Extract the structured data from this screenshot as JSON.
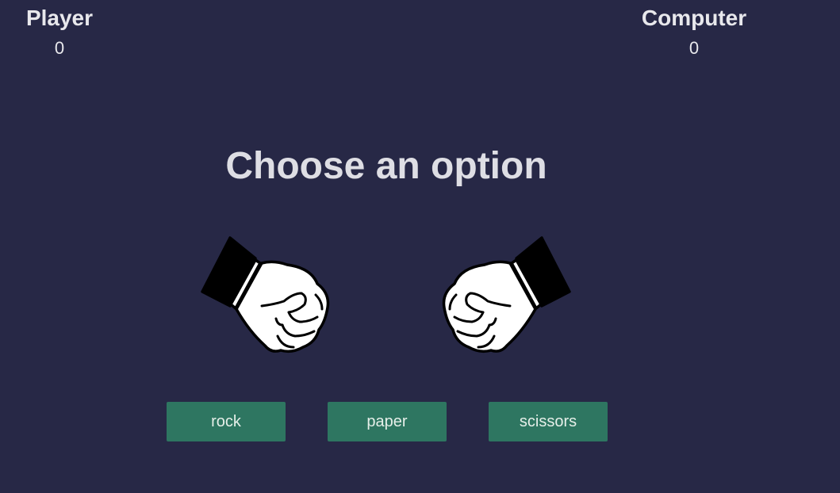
{
  "player": {
    "label": "Player",
    "score": "0"
  },
  "computer": {
    "label": "Computer",
    "score": "0"
  },
  "prompt": "Choose an option",
  "hands": {
    "player_icon": "rock-fist-icon",
    "computer_icon": "rock-fist-icon"
  },
  "buttons": {
    "rock": "rock",
    "paper": "paper",
    "scissors": "scissors"
  },
  "colors": {
    "background": "#272846",
    "button": "#2e7661",
    "text": "#e8e8ec"
  }
}
